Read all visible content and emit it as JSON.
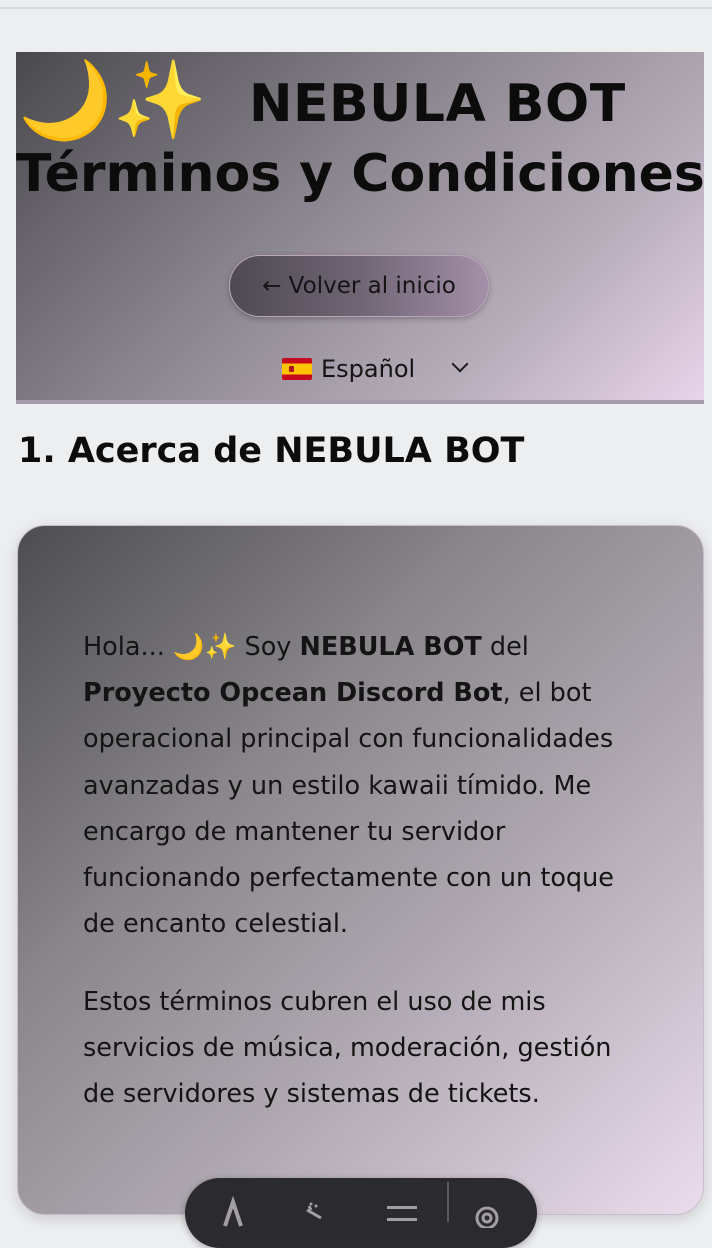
{
  "header": {
    "title_emoji_moon": "🌙",
    "title_emoji_sparkle": "✨",
    "title_line1": "NEBULA BOT",
    "title_line2": "Términos y Condiciones",
    "back_button_label": "← Volver al inicio",
    "language": {
      "selected": "Español",
      "flag_icon": "spain-flag-icon"
    }
  },
  "section": {
    "heading": "1. Acerca de NEBULA BOT"
  },
  "card": {
    "p1_part1": "Hola... 🌙✨ Soy ",
    "p1_bold1": "NEBULA BOT",
    "p1_part2": " del ",
    "p1_bold2": "Proyecto Opcean Discord Bot",
    "p1_part3": ", el bot operacional principal con funcionalidades avanzadas y un estilo kawaii tímido. Me encargo de mantener tu servidor funcionando perfectamente con un toque de encanto celestial.",
    "p2": "Estos términos cubren el uso de mis servicios de música, moderación, gestión de servidores y sistemas de tickets."
  },
  "toolbar": {
    "icons": [
      "text-size-icon",
      "megaphone-icon",
      "menu-icon",
      "settings-gear-icon"
    ]
  },
  "colors": {
    "page_background": "#eceef0",
    "header_gradient_start": "#4a4a4e",
    "header_gradient_end": "#e9d4ea",
    "toolbar_background": "#2b2a2e"
  }
}
